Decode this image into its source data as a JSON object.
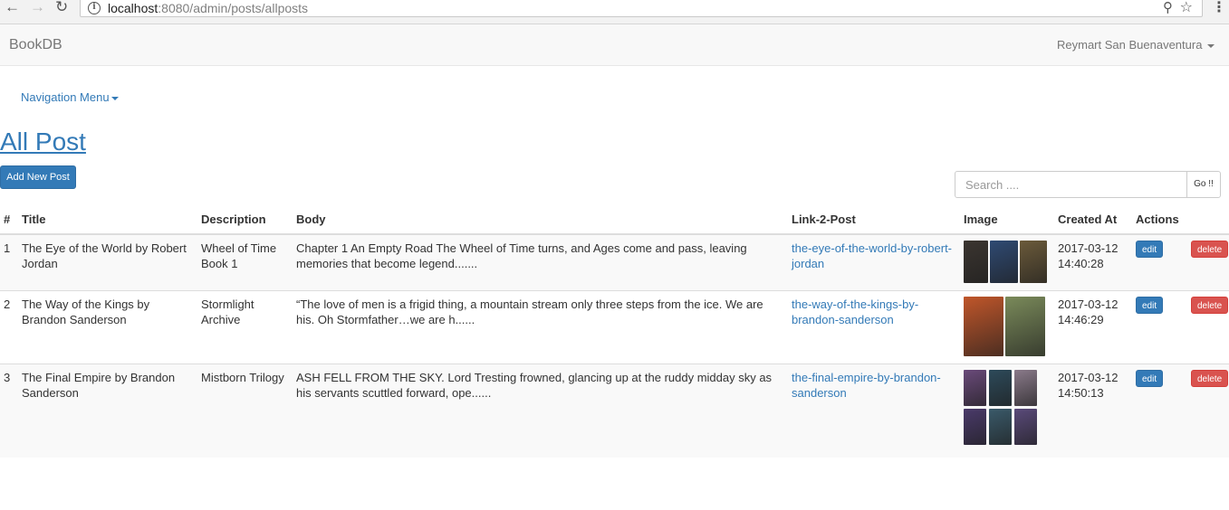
{
  "browser": {
    "url_host": "localhost",
    "url_rest": ":8080/admin/posts/allposts"
  },
  "navbar": {
    "brand": "BookDB",
    "user": "Reymart San Buenaventura"
  },
  "nav_menu": "Navigation Menu",
  "page_title": "All Post",
  "add_button": "Add New Post",
  "search": {
    "placeholder": "Search ....",
    "button": "Go !!"
  },
  "table": {
    "headers": [
      "#",
      "Title",
      "Description",
      "Body",
      "Link-2-Post",
      "Image",
      "Created At",
      "Actions"
    ],
    "rows": [
      {
        "num": "1",
        "title": "The Eye of the World by Robert Jordan",
        "description": "Wheel of Time Book 1",
        "body": "Chapter 1 An Empty Road The Wheel of Time turns, and Ages come and pass, leaving memories that become legend.......",
        "link": "the-eye-of-the-world-by-robert-jordan",
        "created_at": "2017-03-12 14:40:28",
        "edit": "edit",
        "delete": "delete",
        "cover_colors": [
          "#3b3530",
          "#2f4a73",
          "#6b5a3a"
        ]
      },
      {
        "num": "2",
        "title": "The Way of the Kings by Brandon Sanderson",
        "description": "Stormlight Archive",
        "body": "“The love of men is a frigid thing, a mountain stream only three steps from the ice. We are his. Oh Stormfather…we are h......",
        "link": "the-way-of-the-kings-by-brandon-sanderson",
        "created_at": "2017-03-12 14:46:29",
        "edit": "edit",
        "delete": "delete",
        "cover_colors": [
          "#c0562a",
          "#7a8a5a"
        ]
      },
      {
        "num": "3",
        "title": "The Final Empire by Brandon Sanderson",
        "description": "Mistborn Trilogy",
        "body": "ASH FELL FROM THE SKY. Lord Tresting frowned, glancing up at the ruddy midday sky as his servants scuttled forward, ope......",
        "link": "the-final-empire-by-brandon-sanderson",
        "created_at": "2017-03-12 14:50:13",
        "edit": "edit",
        "delete": "delete",
        "cover_colors": [
          "#6a4a7a",
          "#2d4a5a",
          "#8a7a8a",
          "#4a3a6a",
          "#3a5a6a",
          "#5a4a7a"
        ]
      }
    ]
  },
  "colors": {
    "primary": "#337ab7",
    "danger": "#d9534f"
  }
}
